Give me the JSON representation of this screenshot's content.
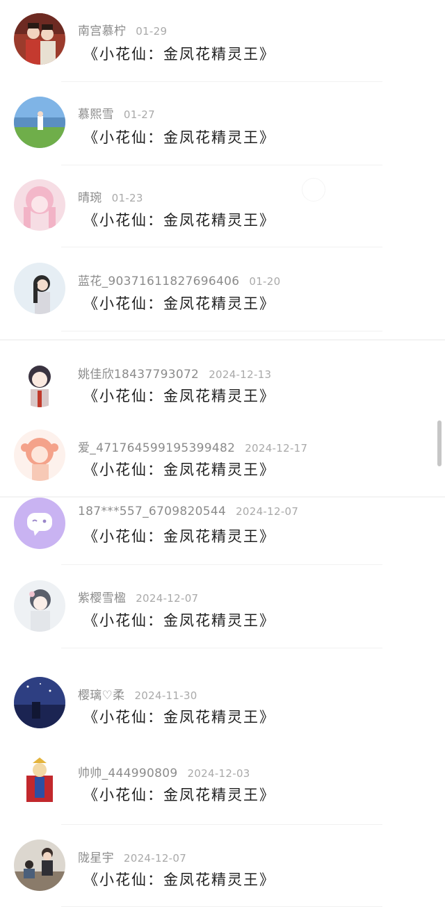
{
  "comments": [
    {
      "name": "南宫慕柠",
      "date": "01-29",
      "message": "《小花仙：金凤花精灵王》",
      "avatar": "avatar-couple-icon"
    },
    {
      "name": "慕熙雪",
      "date": "01-27",
      "message": "《小花仙：金凤花精灵王》",
      "avatar": "avatar-landscape-icon"
    },
    {
      "name": "晴琬",
      "date": "01-23",
      "message": "《小花仙：金凤花精灵王》",
      "avatar": "avatar-pink-anime-icon"
    },
    {
      "name": "蓝花_90371611827696406",
      "date": "01-20",
      "message": "《小花仙：金凤花精灵王》",
      "avatar": "avatar-girl-icon"
    },
    {
      "name": "姚佳欣18437793072",
      "date": "2024-12-13",
      "message": "《小花仙：金凤花精灵王》",
      "avatar": "avatar-anime-girl-icon"
    },
    {
      "name": "爱_471764599195399482",
      "date": "2024-12-17",
      "message": "《小花仙：金凤花精灵王》",
      "avatar": "avatar-orange-hair-icon"
    },
    {
      "name": "187***557_6709820544",
      "date": "2024-12-07",
      "message": "《小花仙：金凤花精灵王》",
      "avatar": "avatar-default-chat-icon"
    },
    {
      "name": "紫樱雪楹",
      "date": "2024-12-07",
      "message": "《小花仙：金凤花精灵王》",
      "avatar": "avatar-ancient-girl-icon"
    },
    {
      "name": "樱璃♡柔",
      "date": "2024-11-30",
      "message": "《小花仙：金凤花精灵王》",
      "avatar": "avatar-night-sky-icon"
    },
    {
      "name": "帅帅_444990809",
      "date": "2024-12-03",
      "message": "《小花仙：金凤花精灵王》",
      "avatar": "avatar-hero-icon"
    },
    {
      "name": "陇星宇",
      "date": "2024-12-07",
      "message": "《小花仙：金凤花精灵王》",
      "avatar": "avatar-classroom-icon"
    }
  ],
  "colors": {
    "name": "#8b8b8b",
    "date": "#a9a9a9",
    "message": "#1f1f1f",
    "default_avatar": "#c9b3f2"
  }
}
